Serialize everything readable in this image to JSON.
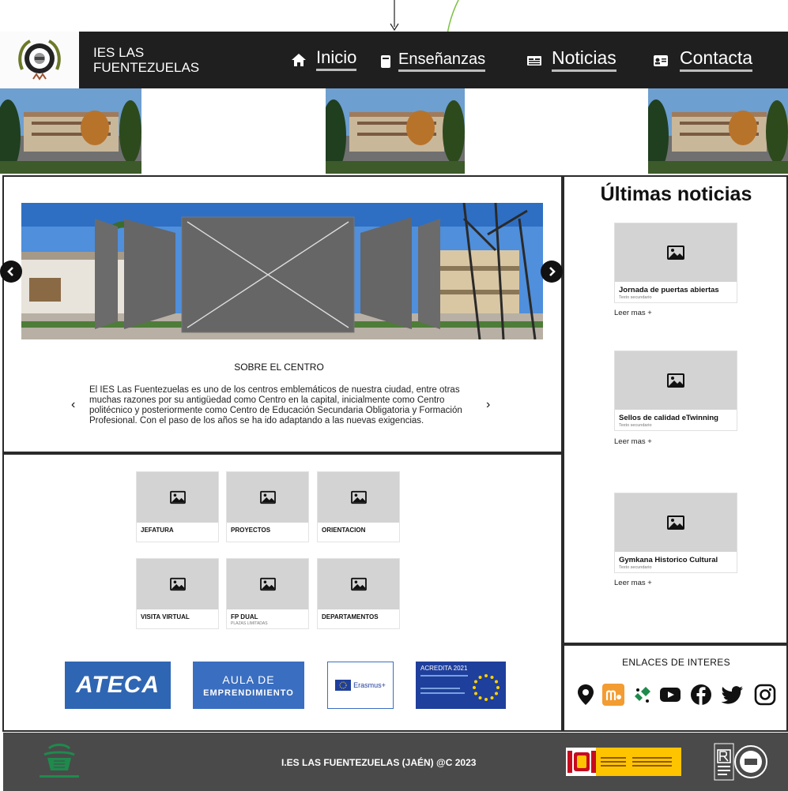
{
  "header": {
    "site_name_line1": "IES LAS",
    "site_name_line2": "FUENTEZUELAS",
    "nav": [
      {
        "label": "Inicio",
        "icon": "home-icon"
      },
      {
        "label": "Enseñanzas",
        "icon": "book-icon"
      },
      {
        "label": "Noticias",
        "icon": "newspaper-icon"
      },
      {
        "label": "Contacta",
        "icon": "contact-card-icon"
      }
    ]
  },
  "about": {
    "title": "SOBRE EL CENTRO",
    "text": "El IES Las Fuentezuelas es uno de los centros emblemáticos de nuestra ciudad, entre otras muchas razones por su antigüedad como Centro en la capital, inicialmente como Centro politécnico y posteriormente como Centro de Educación Secundaria Obligatoria y Formación Profesional. Con el paso de los años se ha ido adaptando a las nuevas exigencias.",
    "prev_symbol": "‹",
    "next_symbol": "›"
  },
  "news": {
    "title": "Últimas noticias",
    "items": [
      {
        "title": "Jornada de puertas abiertas",
        "subtitle": "Texto secundario",
        "link": "Leer mas +"
      },
      {
        "title": "Sellos de calidad eTwinning",
        "subtitle": "Texto secundario",
        "link": "Leer mas +"
      },
      {
        "title": "Gymkana Historico Cultural",
        "subtitle": "Texto secundario",
        "link": "Leer mas +"
      }
    ]
  },
  "tiles": [
    {
      "title": "JEFATURA",
      "subtitle": ""
    },
    {
      "title": "PROYECTOS",
      "subtitle": ""
    },
    {
      "title": "ORIENTACION",
      "subtitle": ""
    },
    {
      "title": "VISITA VIRTUAL",
      "subtitle": ""
    },
    {
      "title": "FP DUAL",
      "subtitle": "PLAZAS LIMITADAS"
    },
    {
      "title": "DEPARTAMENTOS",
      "subtitle": ""
    }
  ],
  "partners": {
    "ateca": "ATECA",
    "aula_line1": "AULA DE",
    "aula_line2": "EMPRENDIMIENTO",
    "erasmus": "Erasmus+",
    "acredita_title": "ACREDITA 2021"
  },
  "links": {
    "title": "ENLACES DE INTERES",
    "icons": [
      "map-pin-icon",
      "moodle-icon",
      "classroom-icon",
      "youtube-icon",
      "facebook-icon",
      "twitter-icon",
      "instagram-icon"
    ]
  },
  "footer": {
    "text": "I.ES LAS FUENTEZUELAS (JAÉN) @C 2023"
  },
  "colors": {
    "header_bg": "#1f1f1f",
    "footer_bg": "#4a4a4a",
    "placeholder": "#d3d3d3",
    "ateca_blue": "#2f66b3",
    "acredita_blue": "#1f3f9c",
    "connector_green": "#7cc242"
  }
}
